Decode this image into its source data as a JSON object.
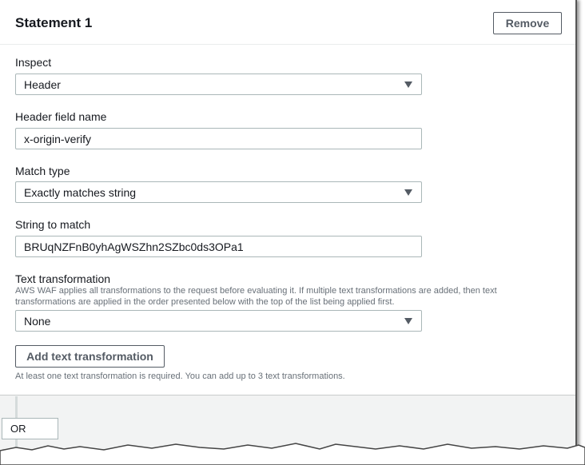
{
  "statement": {
    "title": "Statement 1",
    "remove_label": "Remove"
  },
  "inspect": {
    "label": "Inspect",
    "value": "Header"
  },
  "header_field": {
    "label": "Header field name",
    "value": "x-origin-verify"
  },
  "match_type": {
    "label": "Match type",
    "value": "Exactly matches string"
  },
  "string_to_match": {
    "label": "String to match",
    "value": "BRUqNZFnB0yhAgWSZhn2SZbc0ds3OPa1"
  },
  "text_transformation": {
    "label": "Text transformation",
    "description": "AWS WAF applies all transformations to the request before evaluating it. If multiple text transformations are added, then text transformations are applied in the order presented below with the top of the list being applied first.",
    "value": "None",
    "add_label": "Add text transformation",
    "help": "At least one text transformation is required. You can add up to 3 text transformations."
  },
  "logic": {
    "operator": "OR"
  }
}
